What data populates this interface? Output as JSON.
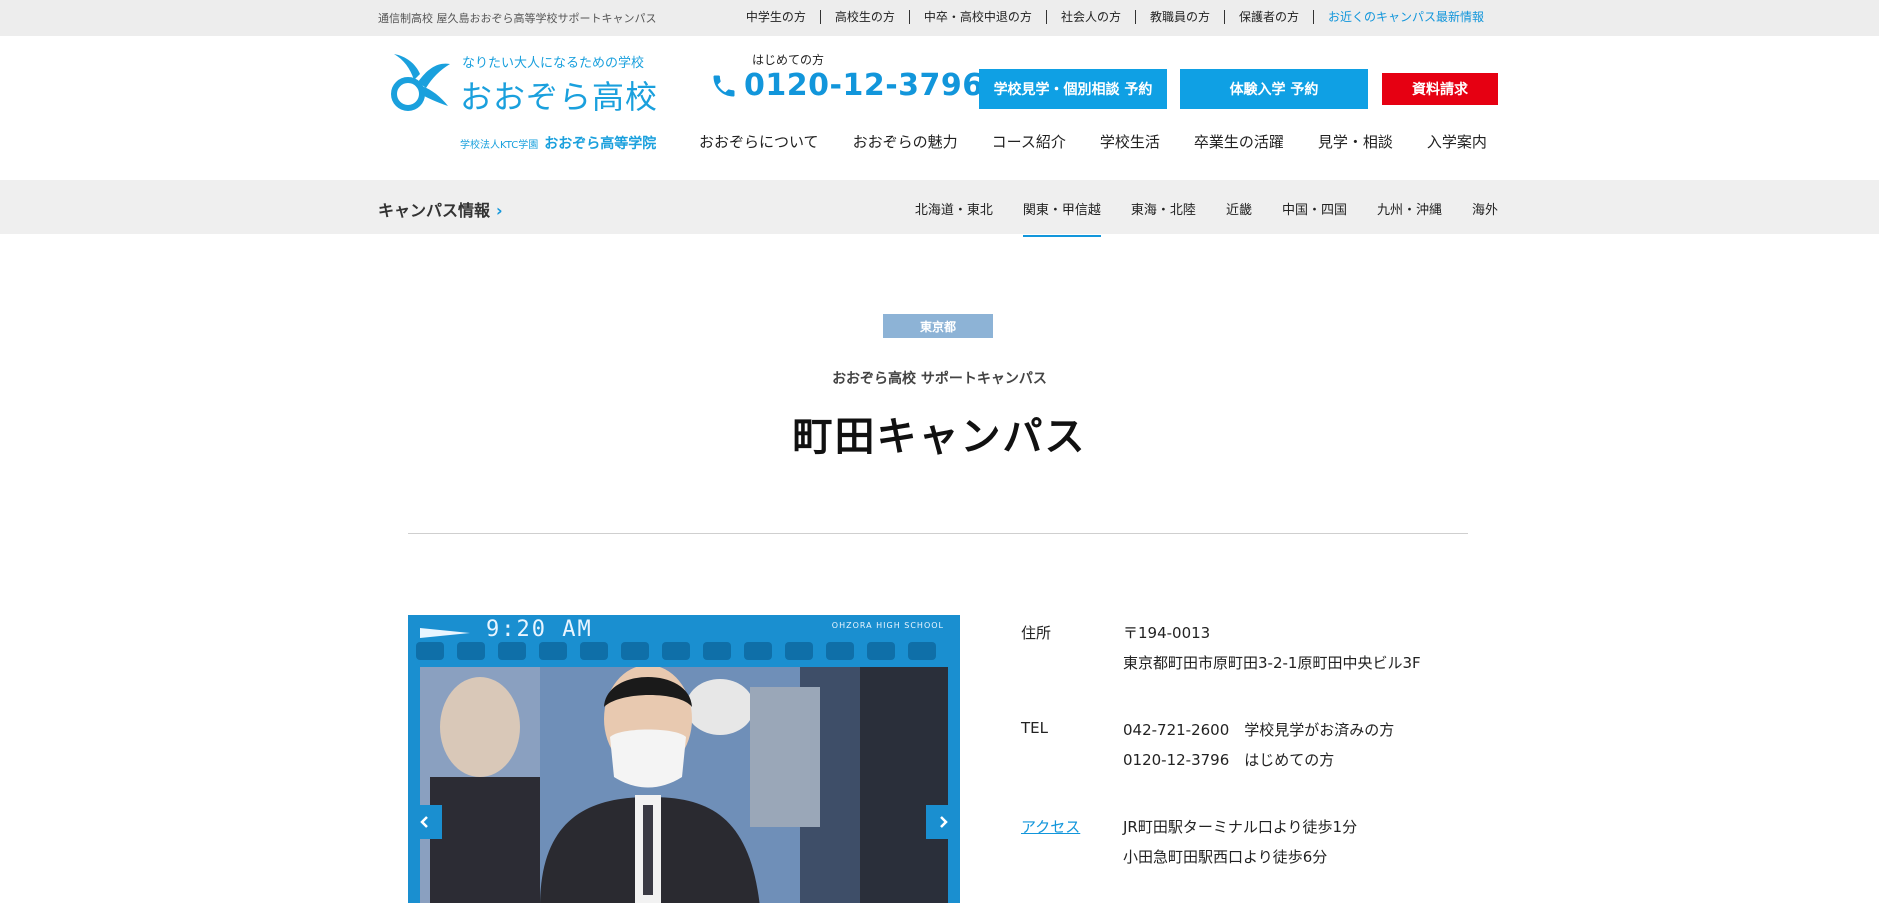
{
  "utility": {
    "tagline": "通信制高校 屋久島おおぞら高等学校サポートキャンパス",
    "links": [
      "中学生の方",
      "高校生の方",
      "中卒・高校中退の方",
      "社会人の方",
      "教職員の方",
      "保護者の方",
      "お近くのキャンパス最新情報"
    ]
  },
  "logo": {
    "tagline": "なりたい大人になるための学校",
    "name": "おおぞら高校",
    "corp": "学校法人KTC学園",
    "school": "おおぞら高等学院"
  },
  "contact": {
    "lead": "はじめての方",
    "phone": "0120-12-3796"
  },
  "cta": {
    "visit": "学校見学・個別相談 予約",
    "trial": "体験入学 予約",
    "docs": "資料請求"
  },
  "mainnav": [
    "おおぞらについて",
    "おおぞらの魅力",
    "コース紹介",
    "学校生活",
    "卒業生の活躍",
    "見学・相談",
    "入学案内"
  ],
  "campusbar": {
    "title": "キャンパス情報",
    "regions": [
      "北海道・東北",
      "関東・甲信越",
      "東海・北陸",
      "近畿",
      "中国・四国",
      "九州・沖縄",
      "海外"
    ],
    "active": "関東・甲信越"
  },
  "campus": {
    "prefecture": "東京都",
    "school_sub": "おおぞら高校 サポートキャンパス",
    "name": "町田キャンパス"
  },
  "photo": {
    "clock": "9:20 AM",
    "brand": "OHZORA HIGH SCHOOL"
  },
  "info": {
    "address_label": "住所",
    "postal": "〒194-0013",
    "address": "東京都町田市原町田3-2-1原町田中央ビル3F",
    "tel_label": "TEL",
    "tel1": "042-721-2600　学校見学がお済みの方",
    "tel2": "0120-12-3796　はじめての方",
    "access_label": "アクセス",
    "access1": "JR町田駅ターミナル口より徒歩1分",
    "access2": "小田急町田駅西口より徒歩6分"
  },
  "colors": {
    "brand_blue": "#1296db",
    "cta_blue": "#0fa0e4",
    "cta_red": "#e60012",
    "pref_badge": "#8db3d6"
  }
}
